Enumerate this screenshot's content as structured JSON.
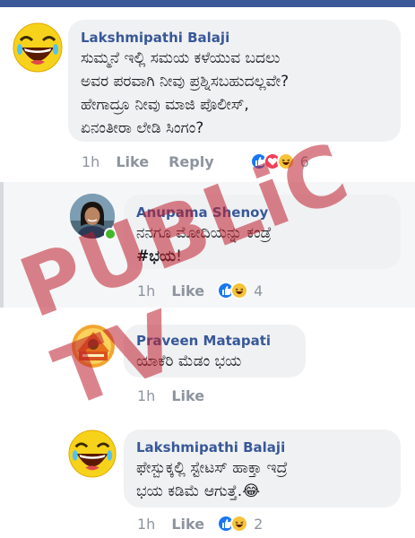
{
  "header_color": "#3b5998",
  "accent_blue": "#385898",
  "watermark": "PUBLiC TV",
  "comments": [
    {
      "author": "Lakshmipathi Balaji",
      "avatar": "laughing-emoji",
      "text": "ಸುಮ್ಮನೆ ಇಲ್ಲಿ ಸಮಯ ಕಳೆಯುವ ಬದಲು\nಅವರ ಪರವಾಗಿ ನೀವು ಪ್ರಶ್ನಿಸಬಹುದಲ್ಲವೇ?\nಹೇಗಾದ್ರೂ ನೀವು ಮಾಜಿ ಪೊಲೀಸ್,\nಏನಂತೀರಾ ಲೇಡಿ ಸಿಂಗಂ?",
      "time": "1h",
      "like": "Like",
      "reply": "Reply",
      "reactions": [
        "like",
        "love",
        "haha"
      ],
      "reaction_count": "6"
    },
    {
      "author": "Anupama Shenoy",
      "avatar": "profile-photo",
      "text_plain": "ನನಗೂ ಮೋದಿಯನ್ನು ಕಂಡ್ರೆ",
      "text_bold": "#ಭಯ",
      "text_end": "!",
      "time": "1h",
      "like": "Like",
      "reactions": [
        "like",
        "haha"
      ],
      "reaction_count": "4"
    },
    {
      "author": "Praveen Matapati",
      "avatar": "profile-badge",
      "text": "ಯಾಕೆರಿ ಮೆಡಂ ಭಯ",
      "time": "1h",
      "like": "Like"
    },
    {
      "author": "Lakshmipathi Balaji",
      "avatar": "laughing-emoji",
      "text": "ಫೇಸ್ಬುಕ್ಕಲ್ಲಿ ಸ್ಟೇಟಸ್ ಹಾಕ್ತಾ ಇದ್ರೆ\nಭಯ ಕಡಿಮೆ ಆಗುತ್ತೆ.😂",
      "time": "1h",
      "like": "Like",
      "reactions": [
        "like",
        "haha"
      ],
      "reaction_count": "2"
    }
  ]
}
